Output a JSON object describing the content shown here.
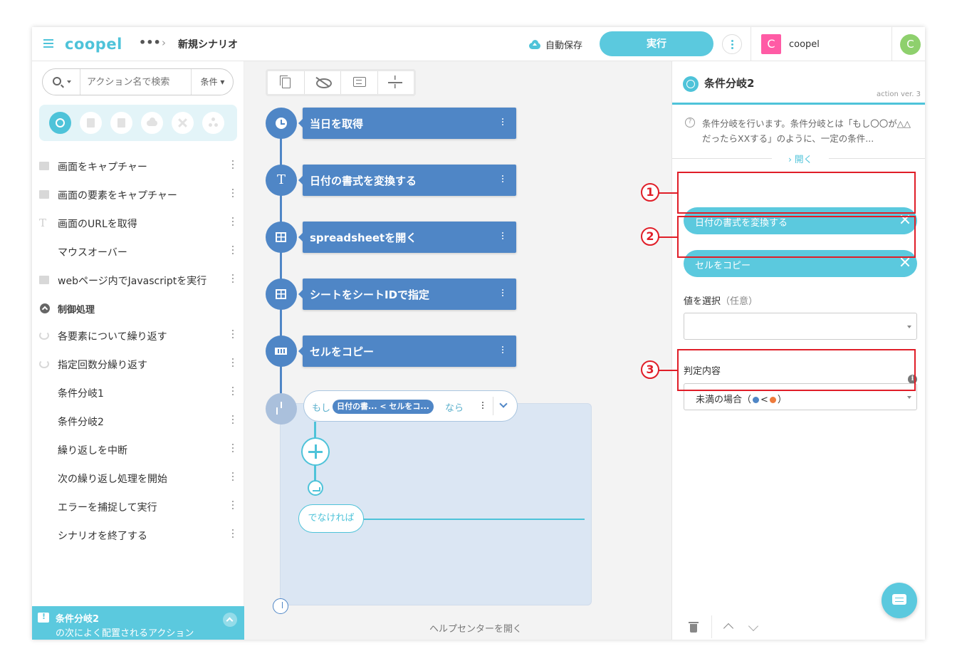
{
  "header": {
    "logo": "coopel",
    "breadcrumb_more": "•••",
    "breadcrumb_sep": "›",
    "title": "新規シナリオ",
    "autosave_label": "自動保存",
    "run_label": "実行",
    "org_initial": "C",
    "org_name": "coopel",
    "user_initial": "C"
  },
  "sidebar": {
    "search_placeholder": "アクション名で検索",
    "search_filter": "条件 ▾",
    "categories": [
      "globe",
      "excel",
      "document",
      "cloud",
      "tools",
      "network"
    ],
    "items_top": [
      {
        "label": "画面をキャプチャー",
        "icon": "image-icon"
      },
      {
        "label": "画面の要素をキャプチャー",
        "icon": "image-icon"
      },
      {
        "label": "画面のURLを取得",
        "icon": "text-icon"
      },
      {
        "label": "マウスオーバー",
        "icon": "none"
      },
      {
        "label": "webページ内でJavascriptを実行",
        "icon": "script-icon"
      }
    ],
    "section_label": "制御処理",
    "items_control": [
      {
        "label": "各要素について繰り返す",
        "icon": "loop-icon"
      },
      {
        "label": "指定回数分繰り返す",
        "icon": "loop-icon"
      },
      {
        "label": "条件分岐1",
        "icon": "none"
      },
      {
        "label": "条件分岐2",
        "icon": "none"
      },
      {
        "label": "繰り返しを中断",
        "icon": "none"
      },
      {
        "label": "次の繰り返し処理を開始",
        "icon": "none"
      },
      {
        "label": "エラーを捕捉して実行",
        "icon": "none"
      },
      {
        "label": "シナリオを終了する",
        "icon": "none"
      }
    ],
    "suggest_title": "条件分岐2",
    "suggest_sub": "の次によく配置されるアクション"
  },
  "canvas": {
    "nodes": [
      {
        "label": "当日を取得",
        "icon": "clock-icon"
      },
      {
        "label": "日付の書式を変換する",
        "icon": "text-icon"
      },
      {
        "label": "spreadsheetを開く",
        "icon": "grid-icon"
      },
      {
        "label": "シートをシートIDで指定",
        "icon": "grid-icon"
      },
      {
        "label": "セルをコピー",
        "icon": "cell-icon"
      }
    ],
    "cond_if": "もし",
    "cond_chip": "日付の書... < セルをコ...",
    "cond_then": "なら",
    "else_label": "でなければ",
    "help_link": "ヘルプセンターを開く"
  },
  "panel": {
    "title": "条件分岐2",
    "version": "action ver. 3",
    "description": "条件分岐を行います。条件分岐とは「もし〇〇が△△だったらXXする」のように、一定の条件...",
    "open_label": "› 開く",
    "var1": "日付の書式を変換する",
    "var2": "セルをコピー",
    "value_label": "値を選択",
    "value_optional": "（任意）",
    "value_selected": "",
    "judge_label": "判定内容",
    "judge_prefix": "未満の場合（",
    "judge_op": "<",
    "judge_suffix": "）",
    "annotations": [
      "1",
      "2",
      "3"
    ],
    "colors": {
      "accent": "#5bc9de",
      "node": "#4f86c6",
      "annotation": "#e01e28"
    }
  }
}
